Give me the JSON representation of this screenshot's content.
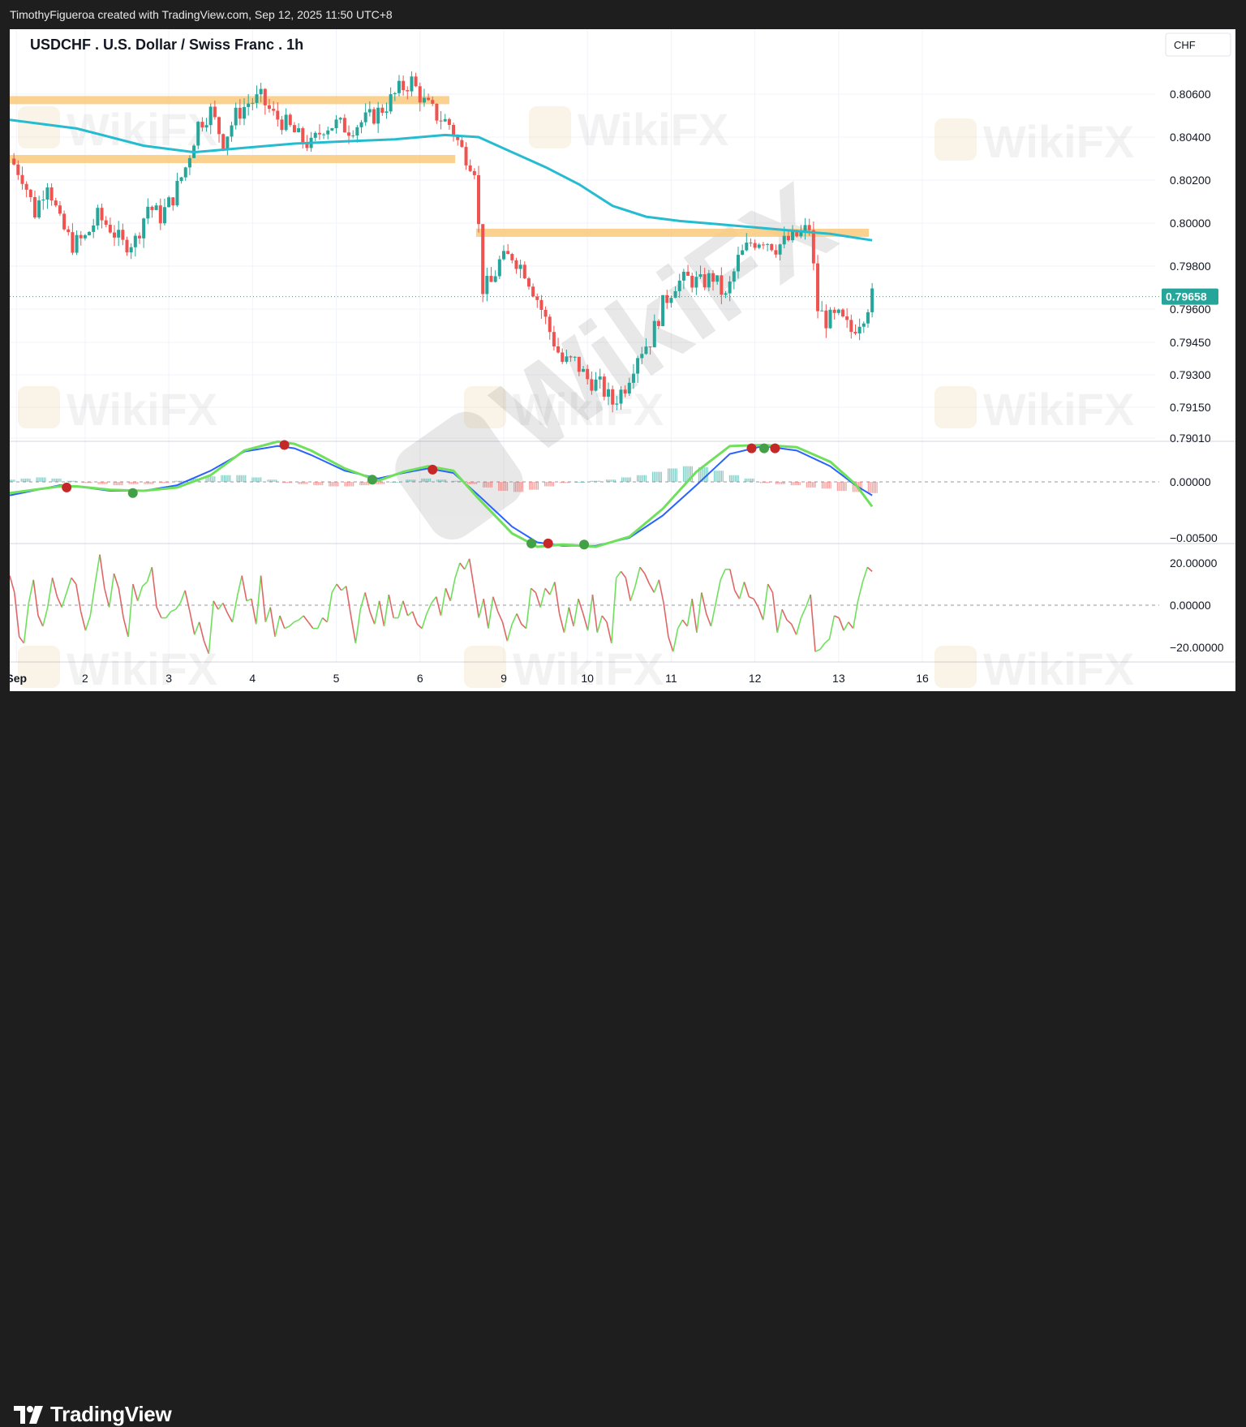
{
  "header": {
    "credit": "TimothyFigueroa created with TradingView.com, Sep 12, 2025 11:50 UTC+8"
  },
  "footer": {
    "brand": "TradingView",
    "logo_icon": "tradingview-logo-icon"
  },
  "watermark": {
    "text": "WikiFX"
  },
  "colors": {
    "up": "#26a69a",
    "down": "#ef5350",
    "ma": "#26bcd0",
    "zone": "#f9c97a",
    "macd_signal": "#b71c1c",
    "macd_line": "#2962ff",
    "osc_up": "#6fe05c",
    "osc_down": "#e06666",
    "price_tag": "#26a69a"
  },
  "chart_data": [
    {
      "type": "candlestick",
      "title": "USDCHF . U.S. Dollar / Swiss Franc . 1h",
      "currency": "CHF",
      "current_price": "0.79658",
      "y_ticks": [
        "0.80600",
        "0.80400",
        "0.80200",
        "0.80000",
        "0.79800",
        "0.79600",
        "0.79450",
        "0.79300",
        "0.79150",
        "0.79010"
      ],
      "x_ticks": [
        "Sep",
        "2",
        "3",
        "4",
        "5",
        "6",
        "9",
        "10",
        "11",
        "12",
        "13",
        "16"
      ],
      "x_start": 0,
      "x_end": 136.8,
      "x_tick_positions": [
        0.8,
        9,
        19,
        29,
        39,
        49,
        59,
        69,
        79,
        89,
        99,
        109
      ],
      "close_path": [
        [
          0,
          0.803
        ],
        [
          1.5,
          0.8022
        ],
        [
          3,
          0.8005
        ],
        [
          4.5,
          0.802
        ],
        [
          6,
          0.8
        ],
        [
          7.5,
          0.799
        ],
        [
          9,
          0.7993
        ],
        [
          10.5,
          0.8003
        ],
        [
          12,
          0.7998
        ],
        [
          13.5,
          0.799
        ],
        [
          15,
          0.7992
        ],
        [
          16.5,
          0.8008
        ],
        [
          18,
          0.8003
        ],
        [
          19.5,
          0.8012
        ],
        [
          21,
          0.8026
        ],
        [
          22.5,
          0.8046
        ],
        [
          24,
          0.8052
        ],
        [
          25.5,
          0.8038
        ],
        [
          27,
          0.805
        ],
        [
          28.5,
          0.8056
        ],
        [
          30,
          0.8058
        ],
        [
          31.5,
          0.805
        ],
        [
          33,
          0.8046
        ],
        [
          34.5,
          0.804
        ],
        [
          36,
          0.8036
        ],
        [
          37.5,
          0.8045
        ],
        [
          39,
          0.8046
        ],
        [
          40.5,
          0.8044
        ],
        [
          42,
          0.8047
        ],
        [
          43.5,
          0.805
        ],
        [
          45,
          0.8055
        ],
        [
          46.5,
          0.8062
        ],
        [
          48,
          0.8066
        ],
        [
          49.5,
          0.8056
        ],
        [
          51,
          0.805
        ],
        [
          52.5,
          0.8046
        ],
        [
          54,
          0.8034
        ],
        [
          55.5,
          0.8026
        ],
        [
          56.5,
          0.797
        ],
        [
          57.5,
          0.7972
        ],
        [
          58.5,
          0.7982
        ],
        [
          60,
          0.7985
        ],
        [
          61.5,
          0.7978
        ],
        [
          63,
          0.7965
        ],
        [
          64.5,
          0.795
        ],
        [
          66,
          0.7936
        ],
        [
          67.5,
          0.7936
        ],
        [
          69,
          0.7928
        ],
        [
          70.5,
          0.7925
        ],
        [
          72,
          0.7917
        ],
        [
          73.5,
          0.7925
        ],
        [
          75,
          0.794
        ],
        [
          76.5,
          0.7946
        ],
        [
          78,
          0.7962
        ],
        [
          79.5,
          0.7972
        ],
        [
          81,
          0.7974
        ],
        [
          82.5,
          0.7972
        ],
        [
          84,
          0.7975
        ],
        [
          85.5,
          0.7965
        ],
        [
          87,
          0.7983
        ],
        [
          88.5,
          0.7991
        ],
        [
          90,
          0.7993
        ],
        [
          91.5,
          0.7989
        ],
        [
          93,
          0.7992
        ],
        [
          94.5,
          0.7995
        ],
        [
          95.5,
          0.7998
        ],
        [
          96.5,
          0.796
        ],
        [
          97.5,
          0.7955
        ],
        [
          99,
          0.7956
        ],
        [
          100.5,
          0.795
        ],
        [
          102,
          0.7958
        ],
        [
          103,
          0.7966
        ]
      ],
      "ma_path": [
        [
          0,
          0.8048
        ],
        [
          8,
          0.8044
        ],
        [
          16,
          0.8036
        ],
        [
          22,
          0.8033
        ],
        [
          28,
          0.8035
        ],
        [
          34,
          0.8037
        ],
        [
          40,
          0.8038
        ],
        [
          46,
          0.8039
        ],
        [
          52,
          0.8041
        ],
        [
          56,
          0.804
        ],
        [
          60,
          0.8033
        ],
        [
          64,
          0.8026
        ],
        [
          68,
          0.8018
        ],
        [
          72,
          0.8008
        ],
        [
          76,
          0.8003
        ],
        [
          80,
          0.8001
        ],
        [
          86,
          0.7999
        ],
        [
          92,
          0.7997
        ],
        [
          98,
          0.7995
        ],
        [
          103,
          0.7992
        ]
      ],
      "zones": [
        {
          "x0": 0,
          "x1": 52.5,
          "y": 0.80572
        },
        {
          "x0": 0,
          "x1": 53.2,
          "y": 0.80298
        },
        {
          "x0": 55.7,
          "x1": 102.6,
          "y": 0.79955
        }
      ]
    },
    {
      "type": "line",
      "panel": "macd",
      "y_ticks": [
        "0.00000",
        "−0.00500"
      ],
      "line_path": [
        [
          0,
          -0.0012
        ],
        [
          6,
          -0.0003
        ],
        [
          8,
          -0.0004
        ],
        [
          12,
          -0.0008
        ],
        [
          16,
          -0.0008
        ],
        [
          20,
          -0.0003
        ],
        [
          24,
          0.001
        ],
        [
          28,
          0.0027
        ],
        [
          32,
          0.0032
        ],
        [
          34,
          0.003
        ],
        [
          36,
          0.0024
        ],
        [
          40,
          0.001
        ],
        [
          44,
          0.0003
        ],
        [
          47,
          0.0008
        ],
        [
          50,
          0.0012
        ],
        [
          53,
          0.0008
        ],
        [
          56,
          -0.0012
        ],
        [
          60,
          -0.004
        ],
        [
          63,
          -0.0054
        ],
        [
          66,
          -0.0057
        ],
        [
          70,
          -0.0057
        ],
        [
          74,
          -0.005
        ],
        [
          78,
          -0.003
        ],
        [
          82,
          -0.0003
        ],
        [
          86,
          0.0025
        ],
        [
          90,
          0.0032
        ],
        [
          94,
          0.0028
        ],
        [
          98,
          0.0014
        ],
        [
          101,
          -0.0003
        ],
        [
          103,
          -0.0012
        ]
      ],
      "signal_path": [
        [
          0,
          -0.001
        ],
        [
          6,
          -0.0004
        ],
        [
          8,
          -0.0004
        ],
        [
          12,
          -0.0007
        ],
        [
          16,
          -0.0008
        ],
        [
          20,
          -0.0005
        ],
        [
          24,
          0.0006
        ],
        [
          28,
          0.0028
        ],
        [
          32,
          0.0036
        ],
        [
          34,
          0.0034
        ],
        [
          36,
          0.0028
        ],
        [
          40,
          0.0012
        ],
        [
          44,
          0.0001
        ],
        [
          47,
          0.0009
        ],
        [
          50,
          0.0014
        ],
        [
          53,
          0.001
        ],
        [
          56,
          -0.0015
        ],
        [
          60,
          -0.0046
        ],
        [
          63,
          -0.0058
        ],
        [
          66,
          -0.0056
        ],
        [
          70,
          -0.0058
        ],
        [
          74,
          -0.0049
        ],
        [
          78,
          -0.0024
        ],
        [
          82,
          0.0009
        ],
        [
          86,
          0.0032
        ],
        [
          90,
          0.0033
        ],
        [
          94,
          0.0031
        ],
        [
          98,
          0.0018
        ],
        [
          101,
          -0.0002
        ],
        [
          103,
          -0.0022
        ]
      ],
      "histogram": [
        0.0002,
        0.0003,
        0.0004,
        0.0003,
        0.0001,
        -0.0001,
        -0.0002,
        -0.0003,
        -0.0002,
        -0.0002,
        -0.0001,
        0.0001,
        0.0003,
        0.0005,
        0.0006,
        0.0006,
        0.0004,
        0.0002,
        -0.0001,
        -0.0002,
        -0.0003,
        -0.0004,
        -0.0004,
        -0.0003,
        -0.0002,
        0.0,
        0.0002,
        0.0003,
        0.0002,
        0.0001,
        -0.0002,
        -0.0005,
        -0.0008,
        -0.0009,
        -0.0007,
        -0.0004,
        -0.0001,
        0.0,
        0.0001,
        0.0002,
        0.0004,
        0.0006,
        0.0009,
        0.0012,
        0.0014,
        0.0013,
        0.001,
        0.0006,
        0.0003,
        -0.0001,
        -0.0002,
        -0.0003,
        -0.0005,
        -0.0006,
        -0.0008,
        -0.0009,
        -0.001
      ],
      "markers": [
        {
          "x": 6.8,
          "y": -0.0005,
          "kind": "down"
        },
        {
          "x": 14.7,
          "y": -0.001,
          "kind": "up"
        },
        {
          "x": 32.8,
          "y": 0.0033,
          "kind": "down"
        },
        {
          "x": 43.3,
          "y": 0.0002,
          "kind": "up"
        },
        {
          "x": 50.5,
          "y": 0.0011,
          "kind": "down"
        },
        {
          "x": 62.3,
          "y": -0.0055,
          "kind": "up"
        },
        {
          "x": 64.3,
          "y": -0.0055,
          "kind": "down"
        },
        {
          "x": 68.6,
          "y": -0.0056,
          "kind": "up"
        },
        {
          "x": 88.6,
          "y": 0.003,
          "kind": "down"
        },
        {
          "x": 90.1,
          "y": 0.003,
          "kind": "up"
        },
        {
          "x": 91.4,
          "y": 0.003,
          "kind": "down"
        }
      ]
    },
    {
      "type": "line",
      "panel": "oscillator",
      "y_ticks": [
        "20.00000",
        "0.00000",
        "−20.00000"
      ],
      "values": [
        14,
        6,
        -15,
        -18,
        1,
        12,
        -5,
        -10,
        -1,
        13,
        4,
        -1,
        6,
        13,
        10,
        -3,
        -12,
        -5,
        10,
        24,
        8,
        -1,
        15,
        8,
        -6,
        -15,
        10,
        2,
        9,
        11,
        18,
        -1,
        -6,
        -6,
        -3,
        -2,
        1,
        7,
        -3,
        -14,
        -8,
        -17,
        -23,
        2,
        -2,
        1,
        -4,
        -8,
        4,
        14,
        2,
        3,
        -9,
        14,
        -8,
        -1,
        -15,
        -5,
        -11,
        -10,
        -8,
        -7,
        -5,
        -8,
        -11,
        -11,
        -6,
        -8,
        6,
        10,
        7,
        9,
        -5,
        -18,
        -2,
        6,
        -3,
        -9,
        2,
        -10,
        5,
        -6,
        -6,
        2,
        -5,
        -3,
        -9,
        -11,
        -4,
        1,
        4,
        -5,
        8,
        2,
        13,
        20,
        17,
        22,
        8,
        -6,
        3,
        -11,
        4,
        -3,
        -8,
        -17,
        -9,
        -4,
        -9,
        -11,
        8,
        6,
        -1,
        8,
        5,
        11,
        -4,
        -13,
        -1,
        -10,
        3,
        -4,
        -12,
        5,
        -13,
        -5,
        -8,
        -18,
        13,
        16,
        13,
        2,
        9,
        18,
        15,
        10,
        6,
        12,
        1,
        -15,
        -22,
        -11,
        -7,
        -10,
        3,
        -13,
        6,
        -4,
        -10,
        1,
        12,
        17,
        17,
        7,
        3,
        11,
        4,
        3,
        -1,
        -7,
        10,
        6,
        -13,
        -2,
        -7,
        -9,
        -14,
        -6,
        -1,
        5,
        -22,
        -21,
        -18,
        -16,
        -5,
        -6,
        -12,
        -8,
        -11,
        2,
        11,
        18,
        16
      ]
    }
  ]
}
